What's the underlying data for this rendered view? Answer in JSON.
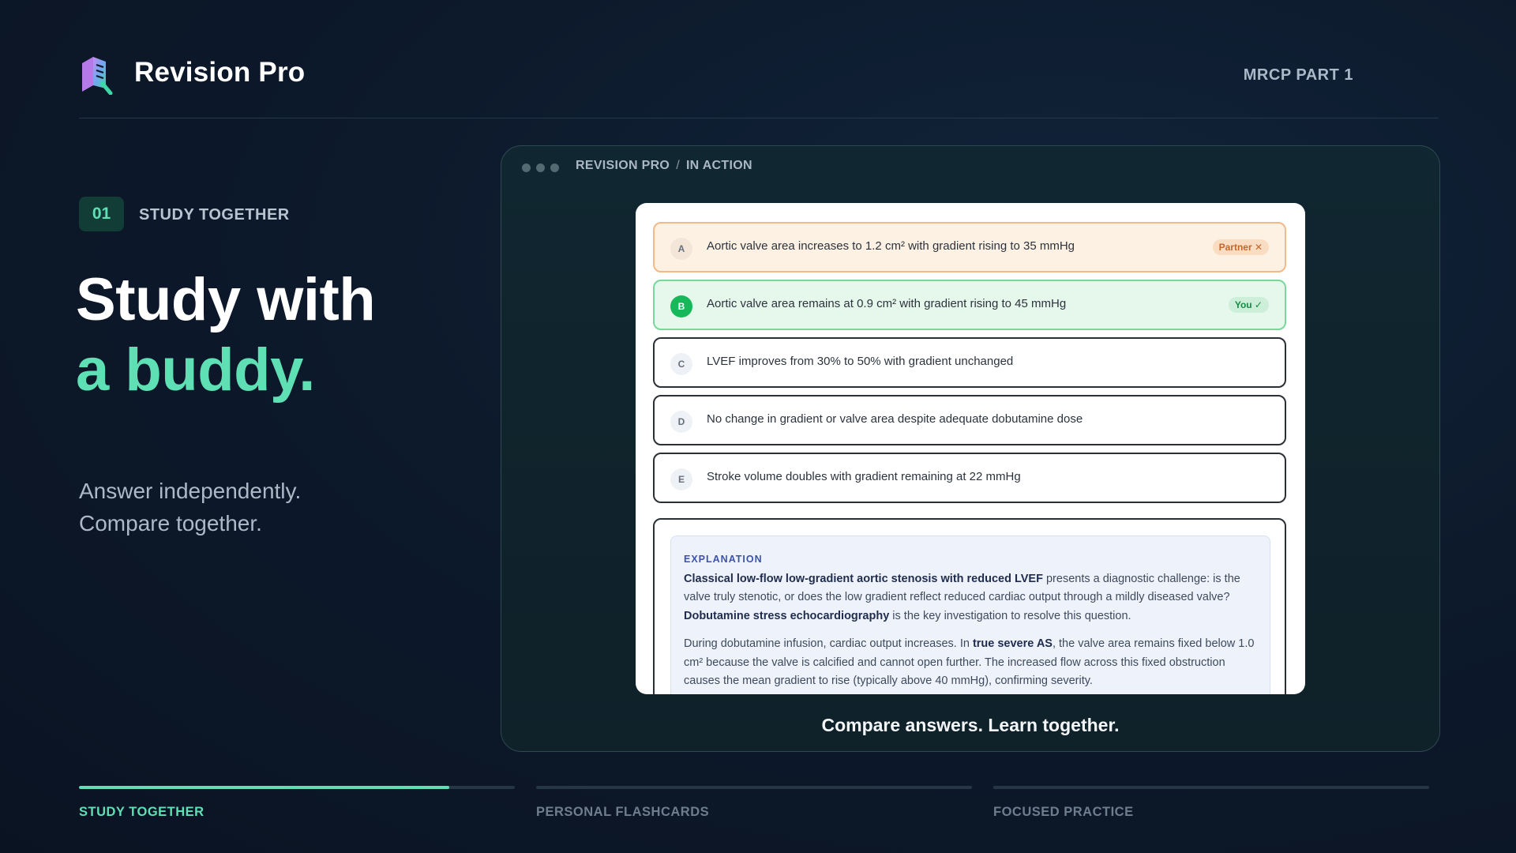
{
  "header": {
    "brand": "Revision Pro",
    "exam": "MRCP PART 1"
  },
  "intro": {
    "step_number": "01",
    "step_label": "STUDY TOGETHER",
    "headline_line1": "Study with",
    "headline_line2": "a buddy.",
    "sub_line1": "Answer independently.",
    "sub_line2": "Compare together."
  },
  "panel": {
    "crumb_1": "REVISION PRO",
    "crumb_sep": "/",
    "crumb_2": "IN ACTION",
    "caption": "Compare answers. Learn together."
  },
  "options": [
    {
      "letter": "A",
      "text": "Aortic valve area increases to 1.2 cm² with gradient rising to 35 mmHg",
      "tag": "Partner ✕"
    },
    {
      "letter": "B",
      "text": "Aortic valve area remains at 0.9 cm² with gradient rising to 45 mmHg",
      "tag": "You ✓"
    },
    {
      "letter": "C",
      "text": "LVEF improves from 30% to 50% with gradient unchanged",
      "tag": ""
    },
    {
      "letter": "D",
      "text": "No change in gradient or valve area despite adequate dobutamine dose",
      "tag": ""
    },
    {
      "letter": "E",
      "text": "Stroke volume doubles with gradient remaining at 22 mmHg",
      "tag": ""
    }
  ],
  "explanation": {
    "title": "EXPLANATION",
    "p1_b1": "Classical low-flow low-gradient aortic stenosis with reduced LVEF",
    "p1_t1": " presents a diagnostic challenge: is the valve truly stenotic, or does the low gradient reflect reduced cardiac output through a mildly diseased valve? ",
    "p1_b2": "Dobutamine stress echocardiography",
    "p1_t2": " is the key investigation to resolve this question.",
    "p2_t1": "During dobutamine infusion, cardiac output increases. In ",
    "p2_b1": "true severe AS",
    "p2_t2": ", the valve area remains fixed below 1.0 cm² because the valve is calcified and cannot open further. The increased flow across this fixed obstruction causes the mean gradient to rise (typically above 40 mmHg), confirming severity."
  },
  "progress": [
    {
      "label": "STUDY TOGETHER",
      "fill": 0.85,
      "active": true
    },
    {
      "label": "PERSONAL FLASHCARDS",
      "fill": 0,
      "active": false
    },
    {
      "label": "FOCUSED PRACTICE",
      "fill": 0,
      "active": false
    }
  ],
  "colors": {
    "accent": "#5ee0b4",
    "partner": "#c2682b",
    "you": "#16b85a"
  }
}
